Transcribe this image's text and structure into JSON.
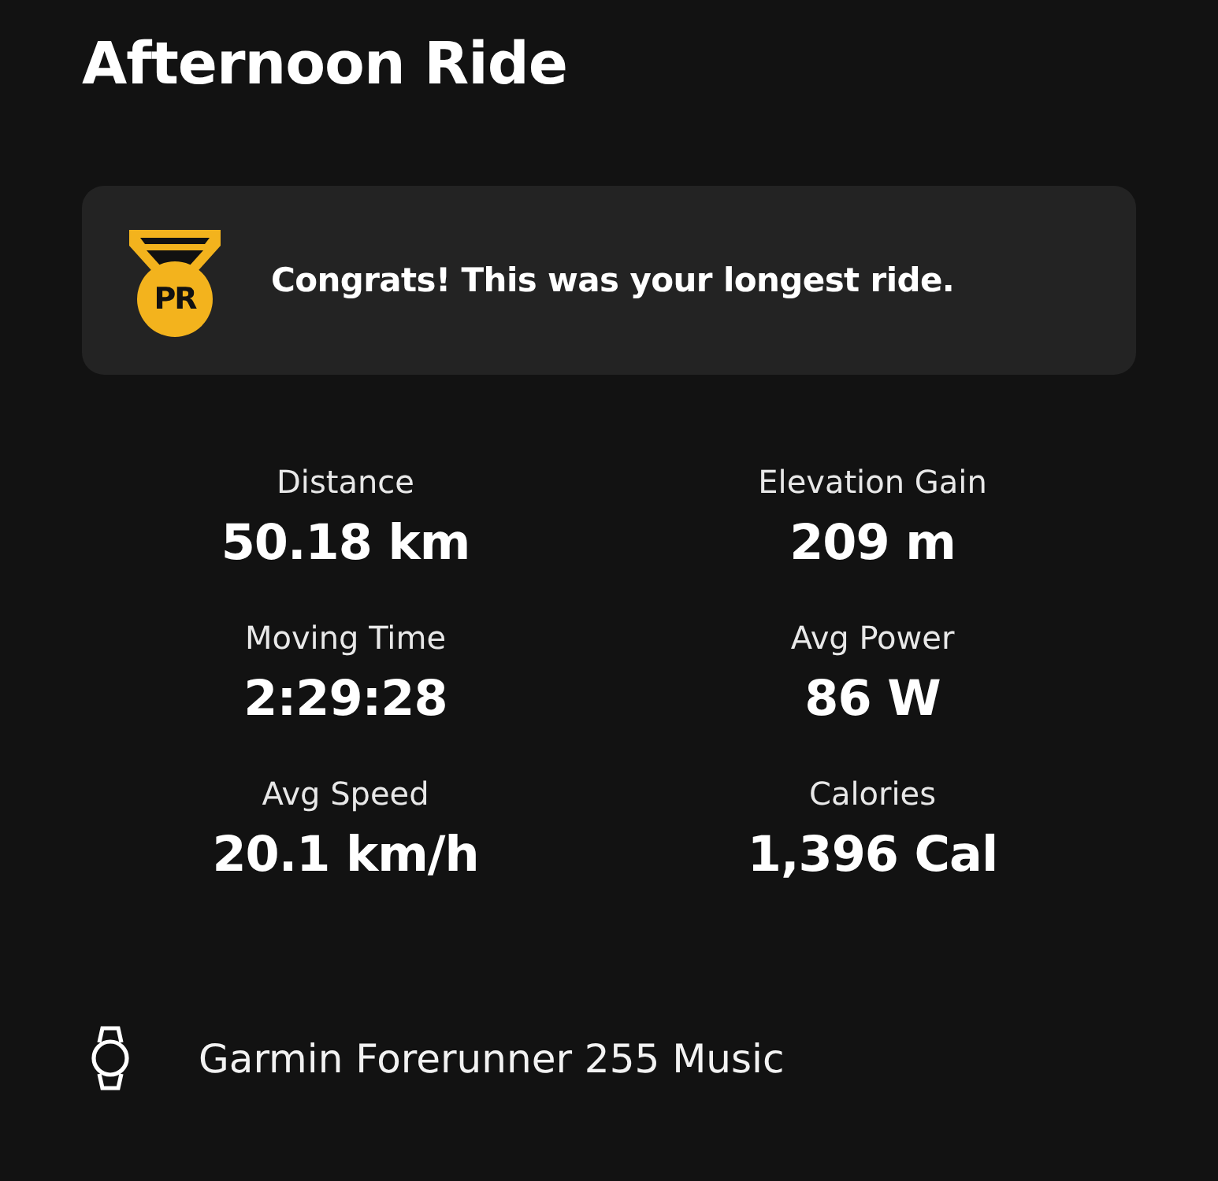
{
  "title": "Afternoon Ride",
  "achievement": {
    "badge": "PR",
    "message": "Congrats! This was your longest ride."
  },
  "stats": [
    {
      "label": "Distance",
      "value": "50.18 km"
    },
    {
      "label": "Elevation Gain",
      "value": "209 m"
    },
    {
      "label": "Moving Time",
      "value": "2:29:28"
    },
    {
      "label": "Avg Power",
      "value": "86 W"
    },
    {
      "label": "Avg Speed",
      "value": "20.1 km/h"
    },
    {
      "label": "Calories",
      "value": "1,396 Cal"
    }
  ],
  "device": {
    "name": "Garmin Forerunner 255 Music"
  }
}
